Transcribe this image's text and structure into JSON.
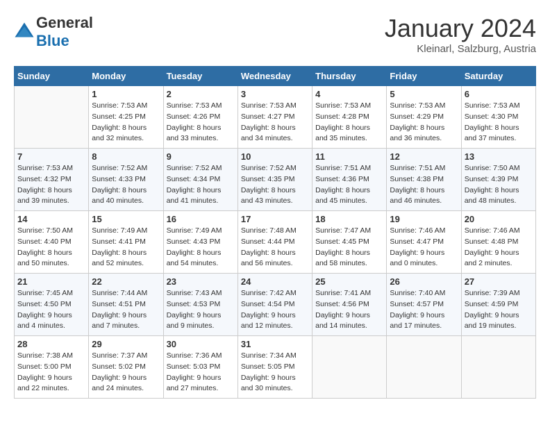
{
  "header": {
    "logo_general": "General",
    "logo_blue": "Blue",
    "month": "January 2024",
    "location": "Kleinarl, Salzburg, Austria"
  },
  "weekdays": [
    "Sunday",
    "Monday",
    "Tuesday",
    "Wednesday",
    "Thursday",
    "Friday",
    "Saturday"
  ],
  "weeks": [
    [
      {
        "day": "",
        "info": ""
      },
      {
        "day": "1",
        "info": "Sunrise: 7:53 AM\nSunset: 4:25 PM\nDaylight: 8 hours\nand 32 minutes."
      },
      {
        "day": "2",
        "info": "Sunrise: 7:53 AM\nSunset: 4:26 PM\nDaylight: 8 hours\nand 33 minutes."
      },
      {
        "day": "3",
        "info": "Sunrise: 7:53 AM\nSunset: 4:27 PM\nDaylight: 8 hours\nand 34 minutes."
      },
      {
        "day": "4",
        "info": "Sunrise: 7:53 AM\nSunset: 4:28 PM\nDaylight: 8 hours\nand 35 minutes."
      },
      {
        "day": "5",
        "info": "Sunrise: 7:53 AM\nSunset: 4:29 PM\nDaylight: 8 hours\nand 36 minutes."
      },
      {
        "day": "6",
        "info": "Sunrise: 7:53 AM\nSunset: 4:30 PM\nDaylight: 8 hours\nand 37 minutes."
      }
    ],
    [
      {
        "day": "7",
        "info": "Sunrise: 7:53 AM\nSunset: 4:32 PM\nDaylight: 8 hours\nand 39 minutes."
      },
      {
        "day": "8",
        "info": "Sunrise: 7:52 AM\nSunset: 4:33 PM\nDaylight: 8 hours\nand 40 minutes."
      },
      {
        "day": "9",
        "info": "Sunrise: 7:52 AM\nSunset: 4:34 PM\nDaylight: 8 hours\nand 41 minutes."
      },
      {
        "day": "10",
        "info": "Sunrise: 7:52 AM\nSunset: 4:35 PM\nDaylight: 8 hours\nand 43 minutes."
      },
      {
        "day": "11",
        "info": "Sunrise: 7:51 AM\nSunset: 4:36 PM\nDaylight: 8 hours\nand 45 minutes."
      },
      {
        "day": "12",
        "info": "Sunrise: 7:51 AM\nSunset: 4:38 PM\nDaylight: 8 hours\nand 46 minutes."
      },
      {
        "day": "13",
        "info": "Sunrise: 7:50 AM\nSunset: 4:39 PM\nDaylight: 8 hours\nand 48 minutes."
      }
    ],
    [
      {
        "day": "14",
        "info": "Sunrise: 7:50 AM\nSunset: 4:40 PM\nDaylight: 8 hours\nand 50 minutes."
      },
      {
        "day": "15",
        "info": "Sunrise: 7:49 AM\nSunset: 4:41 PM\nDaylight: 8 hours\nand 52 minutes."
      },
      {
        "day": "16",
        "info": "Sunrise: 7:49 AM\nSunset: 4:43 PM\nDaylight: 8 hours\nand 54 minutes."
      },
      {
        "day": "17",
        "info": "Sunrise: 7:48 AM\nSunset: 4:44 PM\nDaylight: 8 hours\nand 56 minutes."
      },
      {
        "day": "18",
        "info": "Sunrise: 7:47 AM\nSunset: 4:45 PM\nDaylight: 8 hours\nand 58 minutes."
      },
      {
        "day": "19",
        "info": "Sunrise: 7:46 AM\nSunset: 4:47 PM\nDaylight: 9 hours\nand 0 minutes."
      },
      {
        "day": "20",
        "info": "Sunrise: 7:46 AM\nSunset: 4:48 PM\nDaylight: 9 hours\nand 2 minutes."
      }
    ],
    [
      {
        "day": "21",
        "info": "Sunrise: 7:45 AM\nSunset: 4:50 PM\nDaylight: 9 hours\nand 4 minutes."
      },
      {
        "day": "22",
        "info": "Sunrise: 7:44 AM\nSunset: 4:51 PM\nDaylight: 9 hours\nand 7 minutes."
      },
      {
        "day": "23",
        "info": "Sunrise: 7:43 AM\nSunset: 4:53 PM\nDaylight: 9 hours\nand 9 minutes."
      },
      {
        "day": "24",
        "info": "Sunrise: 7:42 AM\nSunset: 4:54 PM\nDaylight: 9 hours\nand 12 minutes."
      },
      {
        "day": "25",
        "info": "Sunrise: 7:41 AM\nSunset: 4:56 PM\nDaylight: 9 hours\nand 14 minutes."
      },
      {
        "day": "26",
        "info": "Sunrise: 7:40 AM\nSunset: 4:57 PM\nDaylight: 9 hours\nand 17 minutes."
      },
      {
        "day": "27",
        "info": "Sunrise: 7:39 AM\nSunset: 4:59 PM\nDaylight: 9 hours\nand 19 minutes."
      }
    ],
    [
      {
        "day": "28",
        "info": "Sunrise: 7:38 AM\nSunset: 5:00 PM\nDaylight: 9 hours\nand 22 minutes."
      },
      {
        "day": "29",
        "info": "Sunrise: 7:37 AM\nSunset: 5:02 PM\nDaylight: 9 hours\nand 24 minutes."
      },
      {
        "day": "30",
        "info": "Sunrise: 7:36 AM\nSunset: 5:03 PM\nDaylight: 9 hours\nand 27 minutes."
      },
      {
        "day": "31",
        "info": "Sunrise: 7:34 AM\nSunset: 5:05 PM\nDaylight: 9 hours\nand 30 minutes."
      },
      {
        "day": "",
        "info": ""
      },
      {
        "day": "",
        "info": ""
      },
      {
        "day": "",
        "info": ""
      }
    ]
  ]
}
